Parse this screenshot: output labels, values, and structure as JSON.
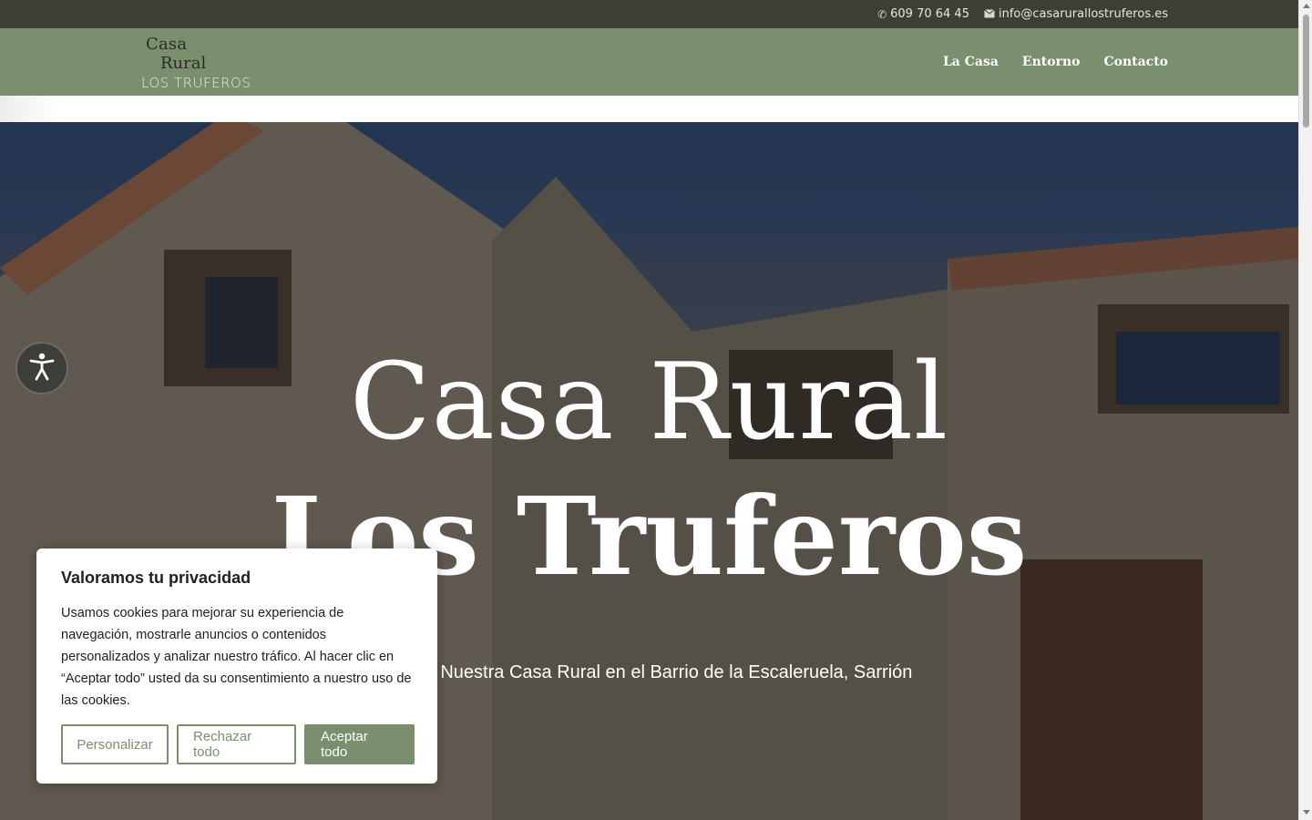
{
  "topbar": {
    "phone_icon": "phone-icon",
    "phone": "609 70 64 45",
    "email_icon": "envelope-icon",
    "email": "info@casarurallostruferos.es"
  },
  "header": {
    "logo": {
      "line1": "Casa",
      "line2": "Rural",
      "line3": "LOS TRUFEROS"
    },
    "nav": [
      "La Casa",
      "Entorno",
      "Contacto"
    ],
    "colors": {
      "header_bg": "#7a8f6e",
      "topbar_bg": "#3d3f36"
    }
  },
  "hero": {
    "title_line1": "Casa Rural",
    "title_line2": "Los Truferos",
    "subtitle": "os a Nuestra Casa Rural en el Barrio de la Escaleruela, Sarrión"
  },
  "accessibility": {
    "icon": "accessibility-icon"
  },
  "cookie": {
    "title": "Valoramos tu privacidad",
    "text": "Usamos cookies para mejorar su experiencia de navegación, mostrarle anuncios o contenidos personalizados y analizar nuestro tráfico. Al hacer clic en “Aceptar todo” usted da su consentimiento a nuestro uso de las cookies.",
    "buttons": {
      "customize": "Personalizar",
      "reject": "Rechazar todo",
      "accept": "Aceptar todo"
    }
  }
}
